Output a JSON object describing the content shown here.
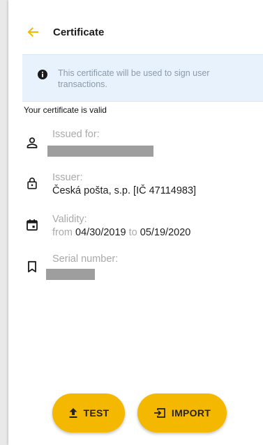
{
  "header": {
    "title": "Certificate",
    "back_icon": "arrow-left-icon"
  },
  "colors": {
    "accent": "#f5b800",
    "banner_bg": "#e8f2fd",
    "muted_text": "#a9a9a9"
  },
  "banner": {
    "icon": "info-icon",
    "text": "This certificate will be used to sign user transactions."
  },
  "status_text": "Your certificate is valid",
  "details": {
    "issued_for": {
      "label": "Issued for:",
      "icon": "person-icon",
      "value_redacted": true
    },
    "issuer": {
      "label": "Issuer:",
      "icon": "lock-icon",
      "value": "Česká pošta, s.p. [IČ 47114983]"
    },
    "validity": {
      "label": "Validity:",
      "icon": "calendar-icon",
      "from_word": "from",
      "from_date": "04/30/2019",
      "to_word": "to",
      "to_date": "05/19/2020"
    },
    "serial": {
      "label": "Serial number:",
      "icon": "bookmark-icon",
      "value_redacted": true
    }
  },
  "actions": {
    "test_label": "TEST",
    "test_icon": "upload-icon",
    "import_label": "IMPORT",
    "import_icon": "import-icon"
  }
}
